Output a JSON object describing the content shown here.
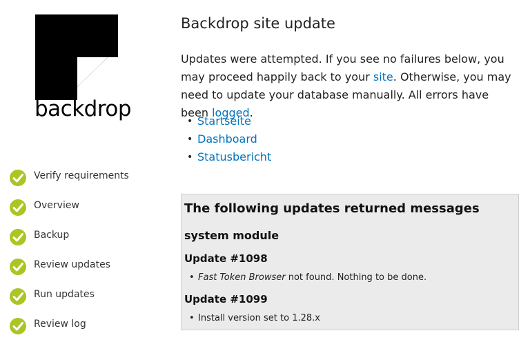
{
  "logo": {
    "text": "backdrop"
  },
  "steps": [
    {
      "label": "Verify requirements",
      "status": "done"
    },
    {
      "label": "Overview",
      "status": "done"
    },
    {
      "label": "Backup",
      "status": "done"
    },
    {
      "label": "Review updates",
      "status": "done"
    },
    {
      "label": "Run updates",
      "status": "done"
    },
    {
      "label": "Review log",
      "status": "done"
    }
  ],
  "main": {
    "title": "Backdrop site update",
    "intro": {
      "part1": "Updates were attempted. If you see no failures below, you may proceed happily back to your ",
      "site_link": "site",
      "part2": ". Otherwise, you may need to update your database manually. All errors have been ",
      "logged_link": "logged",
      "part3": "."
    },
    "links": [
      "Startseite",
      "Dashboard",
      "Statusbericht"
    ]
  },
  "messages": {
    "title": "The following updates returned messages",
    "module": "system module",
    "updates": [
      {
        "heading": "Update #1098",
        "item_em": "Fast Token Browser",
        "item_rest": " not found. Nothing to be done."
      },
      {
        "heading": "Update #1099",
        "item_em": "",
        "item_rest": "Install version set to 1.28.x"
      }
    ]
  },
  "colors": {
    "link": "#0074bd",
    "check": "#aac624",
    "message_bg": "#ebebeb"
  }
}
